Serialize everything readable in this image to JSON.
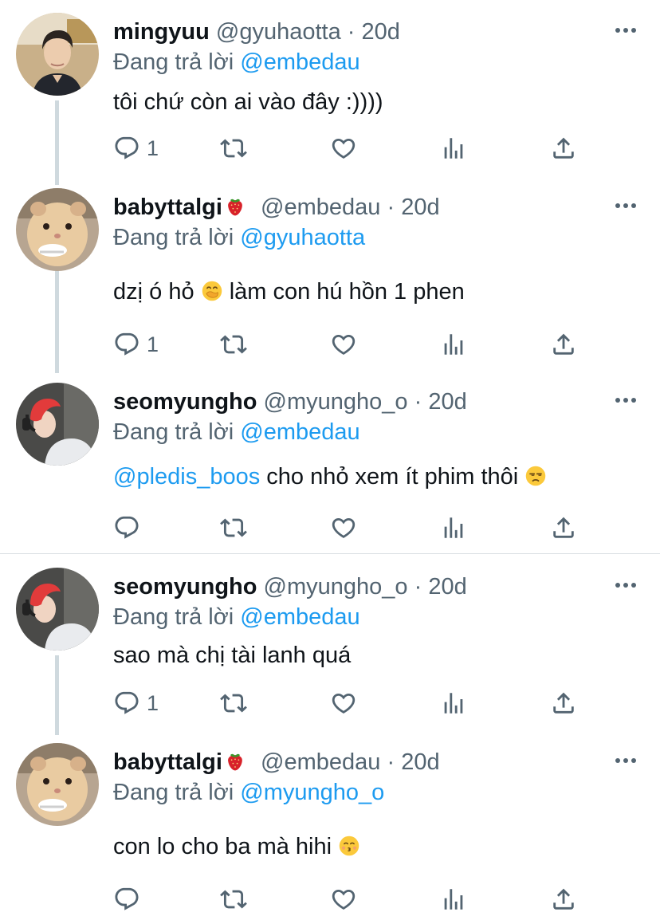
{
  "tweets": [
    {
      "name": "mingyuu",
      "handle": "@gyuhaotta",
      "sep": "·",
      "time": "20d",
      "reply_prefix": "Đang trả lời",
      "reply_to": "@embedau",
      "text": "tôi chứ còn ai vào đây :))))",
      "reply_count": "1",
      "avatar": "man-avatar"
    },
    {
      "name": "babyttalgi",
      "name_badge": "strawberry-emoji",
      "handle": "@embedau",
      "sep": "·",
      "time": "20d",
      "reply_prefix": "Đang trả lời",
      "reply_to": "@gyuhaotta",
      "text_before": "dzị ó hỏ",
      "text_emoji": "hand-over-mouth-emoji",
      "text_after": "làm con hú hồn 1 phen",
      "reply_count": "1",
      "avatar": "hamster-avatar"
    },
    {
      "name": "seomyungho",
      "handle": "@myungho_o",
      "sep": "·",
      "time": "20d",
      "reply_prefix": "Đang trả lời",
      "reply_to": "@embedau",
      "text_mention": "@pledis_boos",
      "text_after": "cho nhỏ xem ít phim thôi",
      "text_emoji": "unamused-face-emoji",
      "reply_count": "",
      "avatar": "red-hair-avatar"
    },
    {
      "name": "seomyungho",
      "handle": "@myungho_o",
      "sep": "·",
      "time": "20d",
      "reply_prefix": "Đang trả lời",
      "reply_to": "@embedau",
      "text": "sao mà chị tài lanh quá",
      "reply_count": "1",
      "avatar": "red-hair-avatar"
    },
    {
      "name": "babyttalgi",
      "name_badge": "strawberry-emoji",
      "handle": "@embedau",
      "sep": "·",
      "time": "20d",
      "reply_prefix": "Đang trả lời",
      "reply_to": "@myungho_o",
      "text_before": "con lo cho ba mà hihi",
      "text_emoji": "kissing-face-emoji",
      "reply_count": "",
      "avatar": "hamster-avatar"
    }
  ],
  "colors": {
    "text": "#0f1419",
    "secondary": "#536471",
    "link": "#1d9bf0",
    "thread_line": "#cfd9de"
  }
}
